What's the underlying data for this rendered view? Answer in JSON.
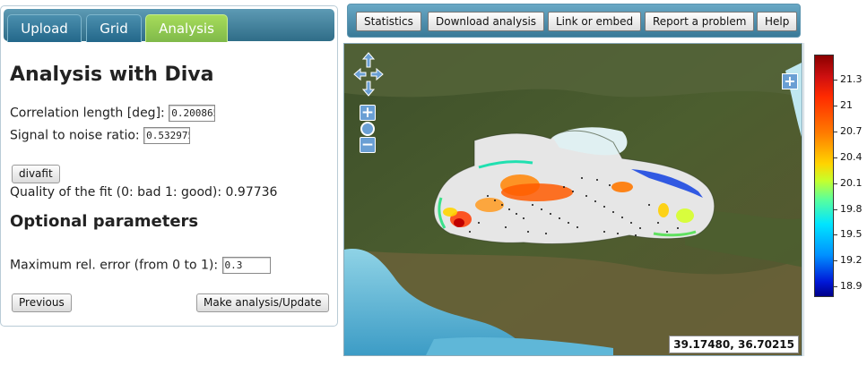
{
  "tabs": [
    {
      "label": "Upload"
    },
    {
      "label": "Grid"
    },
    {
      "label": "Analysis",
      "active": true
    }
  ],
  "panel": {
    "title": "Analysis with Diva",
    "correlation_length": {
      "label": "Correlation length [deg]:",
      "value": "0.200865"
    },
    "signal_to_noise": {
      "label": "Signal to noise ratio:",
      "value": "0.532975"
    },
    "divafit_button": "divafit",
    "quality_text": "Quality of the fit (0: bad 1: good): 0.97736",
    "optional_title": "Optional parameters",
    "max_rel_error": {
      "label": "Maximum rel. error (from 0 to 1):",
      "value": "0.3"
    },
    "previous_button": "Previous",
    "update_button": "Make analysis/Update"
  },
  "toolbar": {
    "buttons": [
      "Statistics",
      "Download analysis",
      "Link or embed",
      "Report a problem",
      "Help"
    ]
  },
  "map": {
    "coordinates": "39.17480, 36.70215",
    "controls": {
      "pan_icon": "pan-arrows-icon",
      "zoom_in": "+",
      "zoom_out": "−",
      "layer_switcher": "+"
    }
  },
  "legend": {
    "ticks": [
      "21.3",
      "21",
      "20.7",
      "20.4",
      "20.1",
      "19.8",
      "19.5",
      "19.2",
      "18.9"
    ],
    "colors": {
      "max": "#8b0000",
      "mid": "#ffd400",
      "min": "#00008a"
    }
  },
  "colors": {
    "tab_bar": "#3a7a98",
    "active_tab": "#8fc94f",
    "toolbar": "#4f8fae"
  }
}
